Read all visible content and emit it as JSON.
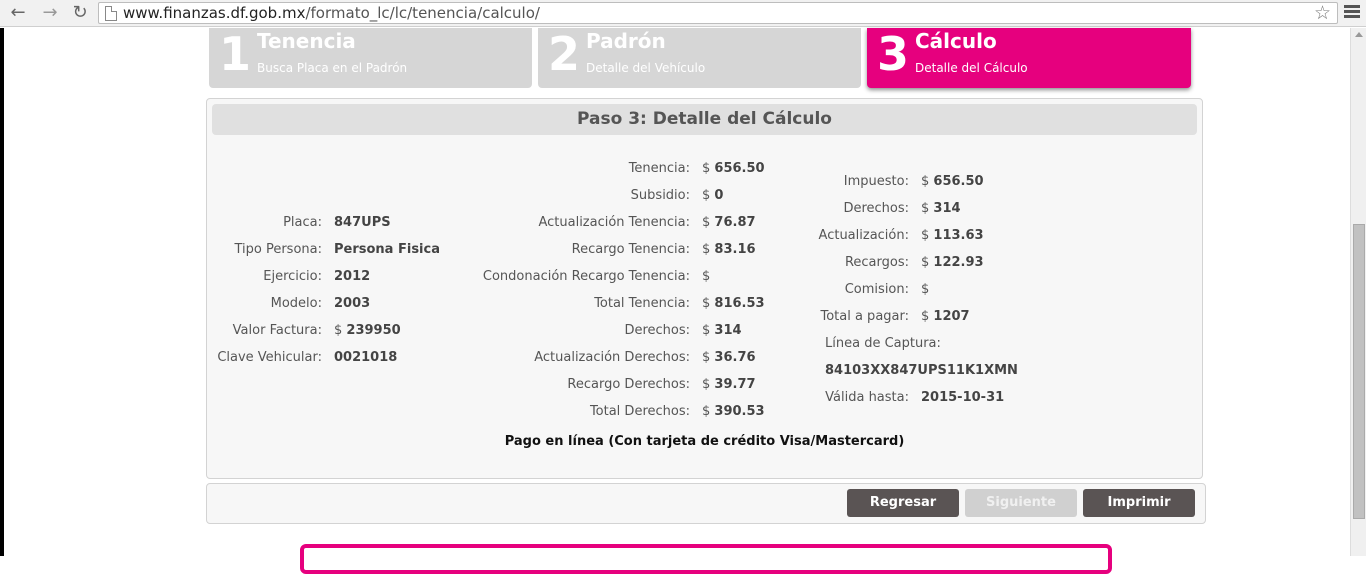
{
  "browser": {
    "url_host": "www.finanzas.df.gob.mx",
    "url_path": "/formato_lc/lc/tenencia/calculo/"
  },
  "steps": [
    {
      "num": "1",
      "title": "Tenencia",
      "sub": "Busca Placa en el Padrón"
    },
    {
      "num": "2",
      "title": "Padrón",
      "sub": "Detalle del Vehículo"
    },
    {
      "num": "3",
      "title": "Cálculo",
      "sub": "Detalle del Cálculo"
    }
  ],
  "colors": {
    "accent": "#e6007e",
    "button_dark": "#5a5454",
    "inactive_step": "#d6d6d6"
  },
  "panel": {
    "title": "Paso 3: Detalle del Cálculo"
  },
  "col1": [
    {
      "label": "Placa:",
      "value": "847UPS",
      "cur": ""
    },
    {
      "label": "Tipo Persona:",
      "value": "Persona Fisica",
      "cur": ""
    },
    {
      "label": "Ejercicio:",
      "value": "2012",
      "cur": ""
    },
    {
      "label": "Modelo:",
      "value": "2003",
      "cur": ""
    },
    {
      "label": "Valor Factura:",
      "value": "239950",
      "cur": "$"
    },
    {
      "label": "Clave Vehicular:",
      "value": "0021018",
      "cur": ""
    }
  ],
  "col2": [
    {
      "label": "Tenencia:",
      "value": "656.50",
      "cur": "$"
    },
    {
      "label": "Subsidio:",
      "value": "0",
      "cur": "$"
    },
    {
      "label": "Actualización Tenencia:",
      "value": "76.87",
      "cur": "$"
    },
    {
      "label": "Recargo Tenencia:",
      "value": "83.16",
      "cur": "$"
    },
    {
      "label": "Condonación Recargo Tenencia:",
      "value": "",
      "cur": "$"
    },
    {
      "label": "Total Tenencia:",
      "value": "816.53",
      "cur": "$"
    },
    {
      "label": "Derechos:",
      "value": "314",
      "cur": "$"
    },
    {
      "label": "Actualización Derechos:",
      "value": "36.76",
      "cur": "$"
    },
    {
      "label": "Recargo Derechos:",
      "value": "39.77",
      "cur": "$"
    },
    {
      "label": "Total Derechos:",
      "value": "390.53",
      "cur": "$"
    }
  ],
  "col3": [
    {
      "label": "Impuesto:",
      "value": "656.50",
      "cur": "$"
    },
    {
      "label": "Derechos:",
      "value": "314",
      "cur": "$"
    },
    {
      "label": "Actualización:",
      "value": "113.63",
      "cur": "$"
    },
    {
      "label": "Recargos:",
      "value": "122.93",
      "cur": "$"
    },
    {
      "label": "Comision:",
      "value": "",
      "cur": "$"
    },
    {
      "label": "Total a pagar:",
      "value": "1207",
      "cur": "$"
    }
  ],
  "captura": {
    "label": "Línea de Captura:",
    "value": "84103XX847UPS11K1XMN",
    "valida_label": "Válida hasta:",
    "valida_value": "2015-10-31"
  },
  "pago": "Pago en línea (Con tarjeta de crédito Visa/Mastercard)",
  "buttons": {
    "regresar": "Regresar",
    "siguiente": "Siguiente",
    "imprimir": "Imprimir"
  }
}
